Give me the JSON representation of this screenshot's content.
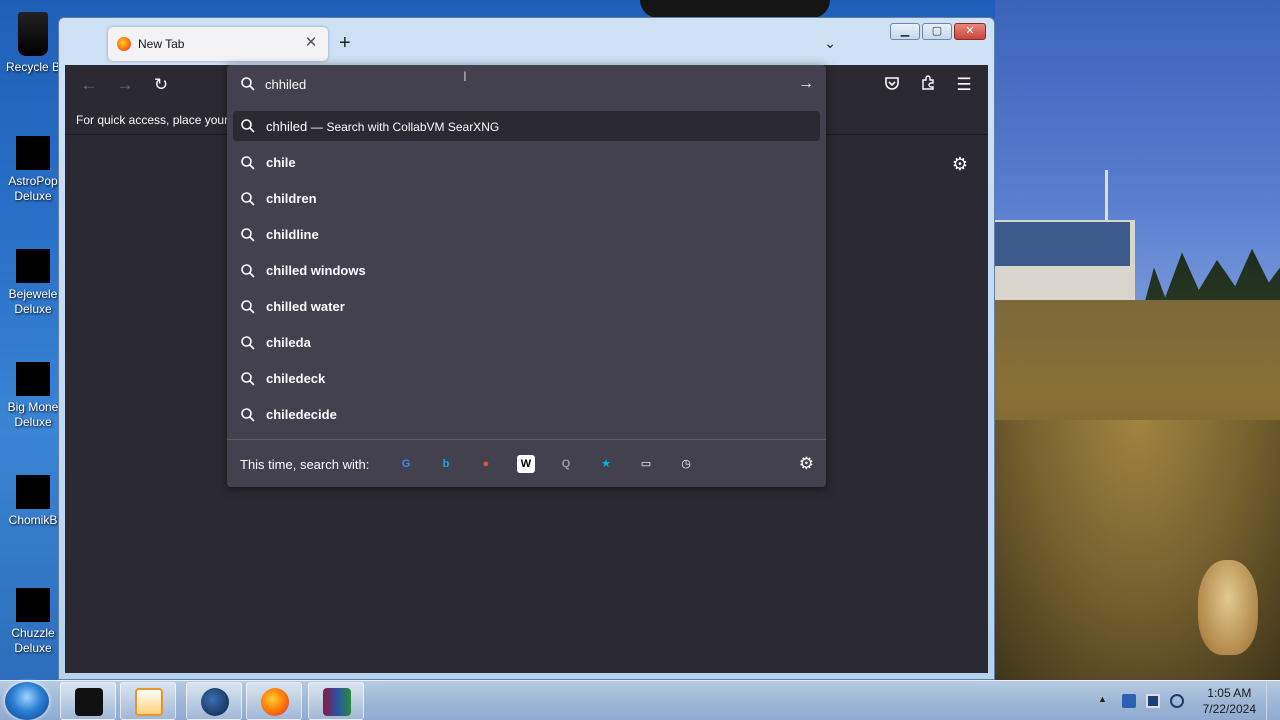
{
  "desktop": {
    "icons": [
      {
        "label": "Recycle B"
      },
      {
        "label": "AstroPop Deluxe"
      },
      {
        "label": "Bejewele Deluxe"
      },
      {
        "label": "Big Mone Deluxe"
      },
      {
        "label": "ChomikB"
      },
      {
        "label": "Chuzzle Deluxe"
      }
    ]
  },
  "browser": {
    "tab_title": "New Tab",
    "new_tab_symbol": "+",
    "bookmarks_hint": "For quick access, place your l",
    "url_input_value": "chhiled",
    "first_suggestion": {
      "query": "chhiled",
      "separator": "—",
      "description": "Search with CollabVM SearXNG"
    },
    "suggestions": [
      "chile",
      "children",
      "childline",
      "chilled windows",
      "chilled water",
      "chileda",
      "chiledeck",
      "chiledecide"
    ],
    "oneoff_label": "This time, search with:",
    "engines": [
      {
        "name": "google-icon",
        "glyph": "G",
        "color": "#4285f4"
      },
      {
        "name": "bing-icon",
        "glyph": "b",
        "color": "#1aa3e8"
      },
      {
        "name": "duckduckgo-icon",
        "glyph": "●",
        "color": "#de5833"
      },
      {
        "name": "wikipedia-icon",
        "glyph": "W",
        "color": "#000000"
      },
      {
        "name": "searxng-icon",
        "glyph": "Q",
        "color": "#9a9a9a"
      },
      {
        "name": "bookmarks-icon",
        "glyph": "★",
        "color": "#00b3f4"
      },
      {
        "name": "tabs-icon",
        "glyph": "▭",
        "color": "#fbfbfe"
      },
      {
        "name": "history-icon",
        "glyph": "◷",
        "color": "#fbfbfe"
      }
    ]
  },
  "taskbar": {
    "clock_time": "1:05 AM",
    "clock_date": "7/22/2024"
  },
  "colors": {
    "browser_bg": "#2b2a33",
    "dropdown_bg": "#42414d",
    "text": "#fbfbfe"
  }
}
